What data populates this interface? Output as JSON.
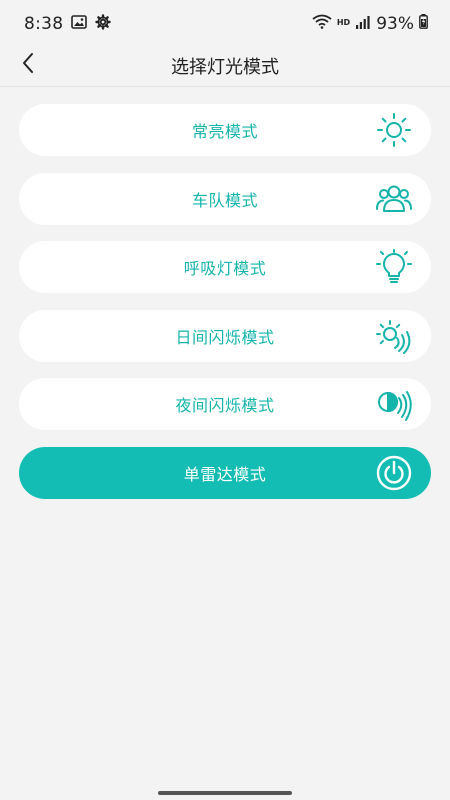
{
  "status_bar": {
    "time": "8:38",
    "network_label": "HD",
    "battery": "93%",
    "icons": [
      "image-icon",
      "settings-gear-icon",
      "wifi-icon",
      "signal-icon",
      "battery-charging-icon"
    ]
  },
  "header": {
    "title": "选择灯光模式",
    "back_icon": "chevron-left-icon"
  },
  "modes": [
    {
      "label": "常亮模式",
      "icon": "sun-icon",
      "selected": false
    },
    {
      "label": "车队模式",
      "icon": "group-people-icon",
      "selected": false
    },
    {
      "label": "呼吸灯模式",
      "icon": "bulb-icon",
      "selected": false
    },
    {
      "label": "日间闪烁模式",
      "icon": "sun-flash-icon",
      "selected": false
    },
    {
      "label": "夜间闪烁模式",
      "icon": "moon-flash-icon",
      "selected": false
    },
    {
      "label": "单雷达模式",
      "icon": "radar-power-icon",
      "selected": true
    }
  ],
  "colors": {
    "accent": "#14bdb4",
    "background": "#f3f3f3",
    "card": "#ffffff"
  }
}
